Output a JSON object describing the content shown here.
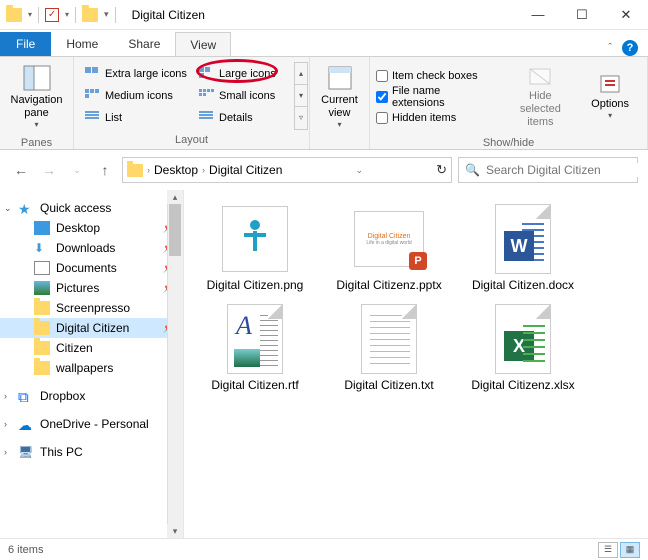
{
  "title": "Digital Citizen",
  "tabs": {
    "file": "File",
    "home": "Home",
    "share": "Share",
    "view": "View"
  },
  "ribbon": {
    "panes": {
      "label": "Panes",
      "navpane": "Navigation pane"
    },
    "layout": {
      "label": "Layout",
      "xl": "Extra large icons",
      "lg": "Large icons",
      "md": "Medium icons",
      "sm": "Small icons",
      "list": "List",
      "details": "Details"
    },
    "current_view": {
      "label": "Current view"
    },
    "showhide": {
      "label": "Show/hide",
      "checkboxes": "Item check boxes",
      "extensions": "File name extensions",
      "hidden": "Hidden items",
      "hideselected": "Hide selected items",
      "options": "Options"
    }
  },
  "breadcrumb": {
    "seg1": "Desktop",
    "seg2": "Digital Citizen"
  },
  "search": {
    "placeholder": "Search Digital Citizen"
  },
  "sidebar": {
    "quick": "Quick access",
    "desktop": "Desktop",
    "downloads": "Downloads",
    "documents": "Documents",
    "pictures": "Pictures",
    "screenpresso": "Screenpresso",
    "digital": "Digital Citizen",
    "citizen": "Citizen",
    "wallpapers": "wallpapers",
    "dropbox": "Dropbox",
    "onedrive": "OneDrive - Personal",
    "thispc": "This PC"
  },
  "files": [
    {
      "name": "Digital Citizen.png"
    },
    {
      "name": "Digital Citizenz.pptx"
    },
    {
      "name": "Digital Citizen.docx"
    },
    {
      "name": "Digital Citizen.rtf"
    },
    {
      "name": "Digital Citizen.txt"
    },
    {
      "name": "Digital Citizenz.xlsx"
    }
  ],
  "status": {
    "count": "6 items"
  },
  "highlight": {
    "target": "Large icons",
    "color": "#d4002a"
  }
}
